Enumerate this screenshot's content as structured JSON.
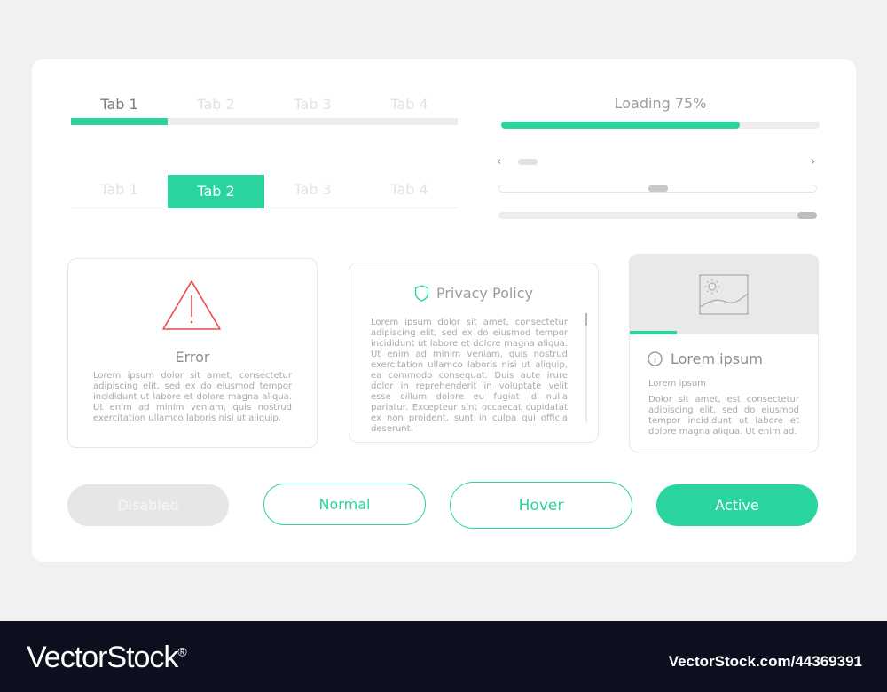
{
  "tabs_underline": {
    "items": [
      "Tab 1",
      "Tab 2",
      "Tab 3",
      "Tab 4"
    ],
    "active_index": 0
  },
  "tabs_pill": {
    "items": [
      "Tab 1",
      "Tab 2",
      "Tab 3",
      "Tab 4"
    ],
    "active_index": 1
  },
  "loading": {
    "label": "Loading 75%",
    "value": 0.75
  },
  "scroller": {
    "prev_glyph": "‹",
    "next_glyph": "›"
  },
  "slider": {
    "value": 0.5
  },
  "range": {
    "value": 1.0
  },
  "error_card": {
    "icon": "warning-triangle-icon",
    "title": "Error",
    "text": "Lorem ipsum dolor sit amet, consectetur adipiscing elit, sed ex do eiusmod tempor incididunt ut labore et dolore magna aliqua. Ut enim ad minim veniam, quis nostrud exercitation ullamco laboris nisi ut aliquip."
  },
  "privacy_card": {
    "icon": "shield-icon",
    "title": "Privacy Policy",
    "text": "Lorem ipsum dolor sit amet, consectetur adipiscing elit, sed ex do eiusmod tempor incididunt ut labore et dolore magna aliqua. Ut enim ad minim veniam, quis nostrud exercitation ullamco laboris nisi ut aliquip, ea commodo consequat. Duis aute irure dolor in reprehenderit in voluptate velit esse cillum dolore eu fugiat id nulla pariatur. Excepteur sint occaecat cupidatat ex non proident, sunt in culpa qui officia deserunt."
  },
  "media_card": {
    "image_icon": "image-placeholder-icon",
    "progress": 0.25,
    "info_icon": "info-icon",
    "title": "Lorem ipsum",
    "subtitle": "Lorem ipsum",
    "text": "Dolor sit amet, est consectetur adipiscing elit, sed do eiusmod tempor incididunt ut labore et dolore magna aliqua. Ut enim ad."
  },
  "buttons": {
    "disabled": "Disabled",
    "normal": "Normal",
    "hover": "Hover",
    "active": "Active"
  },
  "footer": {
    "brand": "VectorStock",
    "registered": "®",
    "image_id": "VectorStock.com/44369391"
  },
  "colors": {
    "accent": "#2ad49f",
    "error": "#e84a4a",
    "background": "#f1f1f1",
    "footer": "#0d0f1e"
  }
}
